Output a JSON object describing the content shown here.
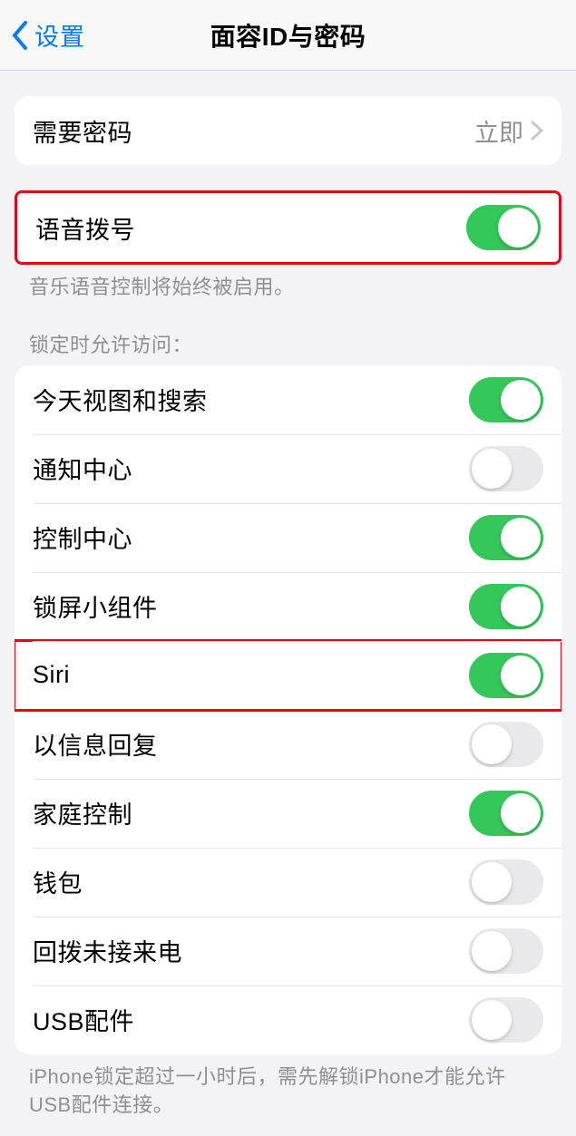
{
  "header": {
    "back_label": "设置",
    "title": "面容ID与密码"
  },
  "require_passcode": {
    "label": "需要密码",
    "value": "立即"
  },
  "voice_dial": {
    "label": "语音拨号",
    "on": true,
    "footer": "音乐语音控制将始终被启用。"
  },
  "lock_access": {
    "header": "锁定时允许访问：",
    "items": [
      {
        "label": "今天视图和搜索",
        "on": true
      },
      {
        "label": "通知中心",
        "on": false
      },
      {
        "label": "控制中心",
        "on": true
      },
      {
        "label": "锁屏小组件",
        "on": true
      },
      {
        "label": "Siri",
        "on": true
      },
      {
        "label": "以信息回复",
        "on": false
      },
      {
        "label": "家庭控制",
        "on": true
      },
      {
        "label": "钱包",
        "on": false
      },
      {
        "label": "回拨未接来电",
        "on": false
      },
      {
        "label": "USB配件",
        "on": false
      }
    ],
    "footer": "iPhone锁定超过一小时后，需先解锁iPhone才能允许USB配件连接。"
  }
}
